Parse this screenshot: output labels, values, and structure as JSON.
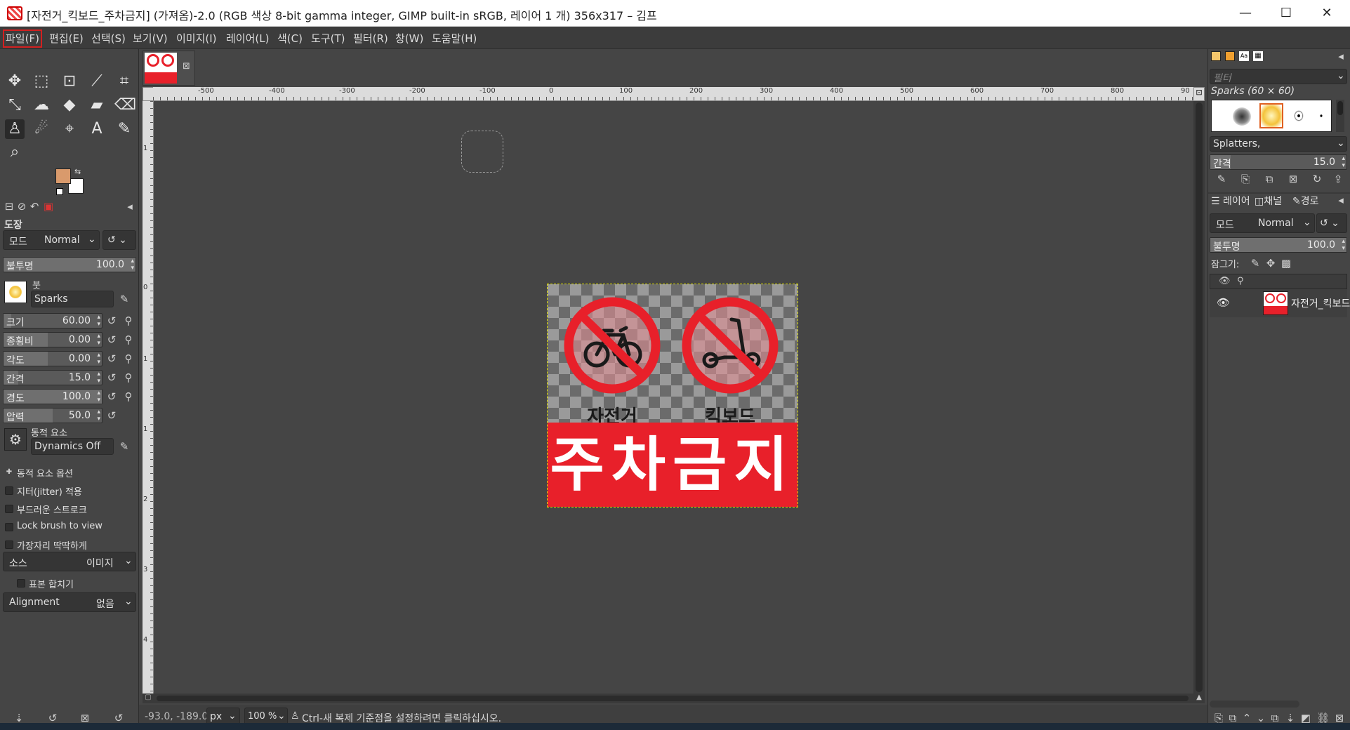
{
  "window": {
    "title": "[자전거_킥보드_주차금지] (가져옴)-2.0 (RGB 색상 8-bit gamma integer, GIMP built-in sRGB, 레이어 1 개) 356x317 – 김프",
    "minimize_glyph": "—",
    "maximize_glyph": "☐",
    "close_glyph": "✕"
  },
  "menu": [
    "파일(F)",
    "편집(E)",
    "선택(S)",
    "보기(V)",
    "이미지(I)",
    "레이어(L)",
    "색(C)",
    "도구(T)",
    "필터(R)",
    "창(W)",
    "도움말(H)"
  ],
  "menu_active_index": 0,
  "toolbox": {
    "tools": [
      "move-icon",
      "rect-select-icon",
      "fuzzy-select-icon",
      "path-icon",
      "crop-icon",
      "transform-icon",
      "warp-icon",
      "bucket-fill-icon",
      "gradient-icon",
      "eraser-icon",
      "clone-icon",
      "smudge-icon",
      "measure-icon",
      "text-icon",
      "color-picker-icon",
      "zoom-icon"
    ],
    "fg_color": "#d99a6c",
    "bg_color": "#ffffff"
  },
  "tool_options": {
    "title": "도장",
    "mode_label": "모드",
    "mode_value": "Normal",
    "opacity_label": "불투명",
    "opacity_value": "100.0",
    "brush_label": "붓",
    "brush_value": "Sparks",
    "size_label": "크기",
    "size_value": "60.00",
    "aspect_label": "종횡비",
    "aspect_value": "0.00",
    "angle_label": "각도",
    "angle_value": "0.00",
    "spacing_label": "간격",
    "spacing_value": "15.0",
    "hardness_label": "경도",
    "hardness_value": "100.0",
    "force_label": "압력",
    "force_value": "50.0",
    "dynamics_label": "동적 요소",
    "dynamics_value": "Dynamics Off",
    "dynamics_options": "동적 요소 옵션",
    "jitter": "지터(jitter) 적용",
    "smooth": "부드러운 스트로크",
    "lock_brush": "Lock brush to view",
    "hard_edge": "가장자리 딱딱하게",
    "source_label": "소스",
    "source_value": "이미지",
    "sample_merged": "표본 합치기",
    "alignment_label": "Alignment",
    "alignment_value": "없음"
  },
  "rulers": {
    "h_ticks": [
      "-500",
      "-400",
      "-300",
      "-200",
      "-100",
      "0",
      "100",
      "200",
      "300",
      "400",
      "500",
      "600",
      "700",
      "800",
      "90"
    ],
    "v_ticks": [
      "1",
      "2",
      "0",
      "1",
      "0",
      "0",
      "0",
      "1",
      "0",
      "0",
      "2",
      "0",
      "0",
      "3",
      "0",
      "0",
      "4",
      "0",
      "0"
    ]
  },
  "sign": {
    "label_left": "자전거",
    "label_right": "킥보드",
    "banner": "주차금지",
    "red": "#e8202a"
  },
  "statusbar": {
    "coords": "-93.0, -189.0",
    "unit": "px",
    "zoom": "100 %",
    "message": "Ctrl-새 복제 기준점을 설정하려면 클릭하십시오."
  },
  "brushes_dock": {
    "filter_placeholder": "필터",
    "brush_name": "Sparks (60 × 60)",
    "tag_value": "Splatters,",
    "spacing_label": "간격",
    "spacing_value": "15.0"
  },
  "layers_dock": {
    "tabs": [
      "레이어",
      "채널",
      "경로"
    ],
    "mode_label": "모드",
    "mode_value": "Normal",
    "opacity_label": "불투명",
    "opacity_value": "100.0",
    "lock_label": "잠그기:",
    "layer_name": "자전거_킥보드"
  }
}
